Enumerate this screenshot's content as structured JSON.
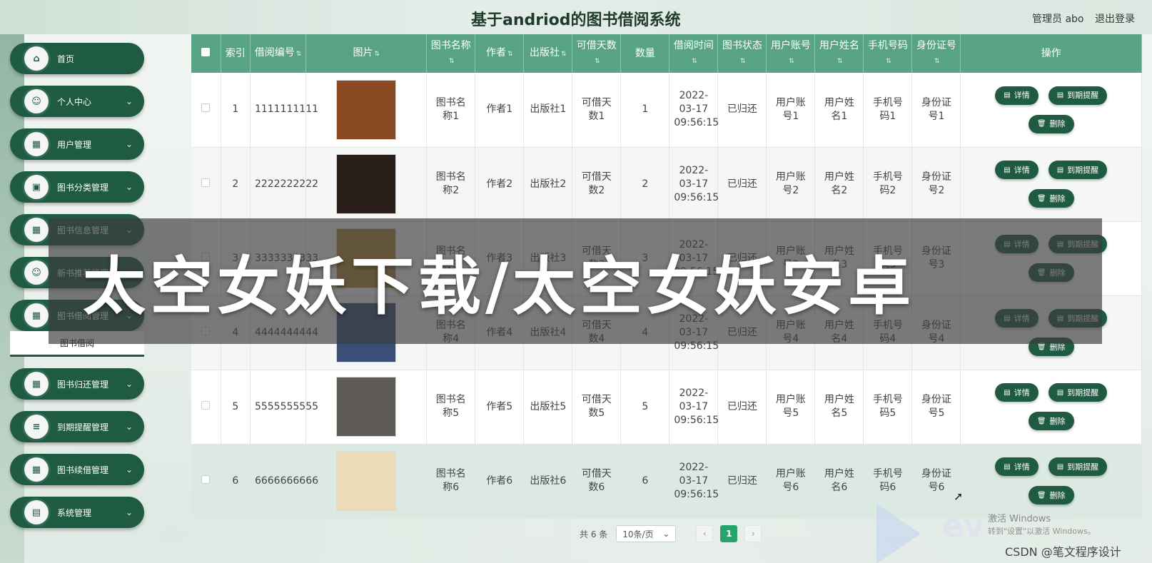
{
  "header": {
    "title": "基于andriod的图书借阅系统",
    "admin": "管理员 abo",
    "logout": "退出登录"
  },
  "sidebar": {
    "items": [
      {
        "label": "首页",
        "icon": "home-icon",
        "glyph": "⌂",
        "chevron": false
      },
      {
        "label": "个人中心",
        "icon": "user-icon",
        "glyph": "☺",
        "chevron": true
      },
      {
        "label": "用户管理",
        "icon": "grid-icon",
        "glyph": "▦",
        "chevron": true
      },
      {
        "label": "图书分类管理",
        "icon": "ticket-icon",
        "glyph": "▣",
        "chevron": true
      },
      {
        "label": "图书信息管理",
        "icon": "grid-icon",
        "glyph": "▦",
        "chevron": true
      },
      {
        "label": "新书推荐管理",
        "icon": "user-icon",
        "glyph": "☺",
        "chevron": true
      },
      {
        "label": "图书借阅管理",
        "icon": "grid-icon",
        "glyph": "▦",
        "chevron": true
      },
      {
        "label": "图书归还管理",
        "icon": "grid-icon",
        "glyph": "▦",
        "chevron": true
      },
      {
        "label": "到期提醒管理",
        "icon": "list-icon",
        "glyph": "≡",
        "chevron": true
      },
      {
        "label": "图书续借管理",
        "icon": "grid-icon",
        "glyph": "▦",
        "chevron": true
      },
      {
        "label": "系统管理",
        "icon": "clipboard-icon",
        "glyph": "▤",
        "chevron": true
      }
    ],
    "sub_item": "图书借阅",
    "chevron_glyph": "⌄"
  },
  "table": {
    "headers": [
      "索引",
      "借阅编号",
      "图片",
      "图书名称",
      "作者",
      "出版社",
      "可借天数",
      "数量",
      "借阅时间",
      "图书状态",
      "用户账号",
      "用户姓名",
      "手机号码",
      "身份证号",
      "操作"
    ],
    "rows": [
      {
        "index": "1",
        "borrow_no": "1111111111",
        "cover_color": "#8a4a22",
        "book_name": "图书名称1",
        "author": "作者1",
        "publisher": "出版社1",
        "days": "可借天数1",
        "qty": "1",
        "time": "2022-03-17 09:56:15",
        "status": "已归还",
        "account": "用户账号1",
        "user_name": "用户姓名1",
        "phone": "手机号码1",
        "id_card": "身份证号1"
      },
      {
        "index": "2",
        "borrow_no": "2222222222",
        "cover_color": "#2a1e1a",
        "book_name": "图书名称2",
        "author": "作者2",
        "publisher": "出版社2",
        "days": "可借天数2",
        "qty": "2",
        "time": "2022-03-17 09:56:15",
        "status": "已归还",
        "account": "用户账号2",
        "user_name": "用户姓名2",
        "phone": "手机号码2",
        "id_card": "身份证号2"
      },
      {
        "index": "3",
        "borrow_no": "3333333333",
        "cover_color": "#b4893d",
        "book_name": "图书名称3",
        "author": "作者3",
        "publisher": "出版社3",
        "days": "可借天数3",
        "qty": "3",
        "time": "2022-03-17 09:56:15",
        "status": "已归还",
        "account": "用户账号3",
        "user_name": "用户姓名3",
        "phone": "手机号码3",
        "id_card": "身份证号3"
      },
      {
        "index": "4",
        "borrow_no": "4444444444",
        "cover_color": "#3a4e78",
        "book_name": "图书名称4",
        "author": "作者4",
        "publisher": "出版社4",
        "days": "可借天数4",
        "qty": "4",
        "time": "2022-03-17 09:56:15",
        "status": "已归还",
        "account": "用户账号4",
        "user_name": "用户姓名4",
        "phone": "手机号码4",
        "id_card": "身份证号4"
      },
      {
        "index": "5",
        "borrow_no": "5555555555",
        "cover_color": "#5e5a56",
        "book_name": "图书名称5",
        "author": "作者5",
        "publisher": "出版社5",
        "days": "可借天数5",
        "qty": "5",
        "time": "2022-03-17 09:56:15",
        "status": "已归还",
        "account": "用户账号5",
        "user_name": "用户姓名5",
        "phone": "手机号码5",
        "id_card": "身份证号5"
      },
      {
        "index": "6",
        "borrow_no": "6666666666",
        "cover_color": "#ecdcb8",
        "book_name": "图书名称6",
        "author": "作者6",
        "publisher": "出版社6",
        "days": "可借天数6",
        "qty": "6",
        "time": "2022-03-17 09:56:15",
        "status": "已归还",
        "account": "用户账号6",
        "user_name": "用户姓名6",
        "phone": "手机号码6",
        "id_card": "身份证号6"
      }
    ],
    "actions": {
      "detail": "详情",
      "remind": "到期提醒",
      "delete": "删除"
    }
  },
  "pagination": {
    "total": "共 6 条",
    "page_size": "10条/页",
    "current_page": "1",
    "prev": "‹",
    "next": "›"
  },
  "overlay": {
    "text": "太空女妖下载/太空女妖安卓"
  },
  "windows": {
    "activate": "激活 Windows",
    "hint": "转到\"设置\"以激活 Windows。"
  },
  "watermark": "CSDN @笔文程序设计",
  "colors": {
    "brand": "#1f5a42",
    "header": "#58a383",
    "active_page": "#27a36b"
  }
}
